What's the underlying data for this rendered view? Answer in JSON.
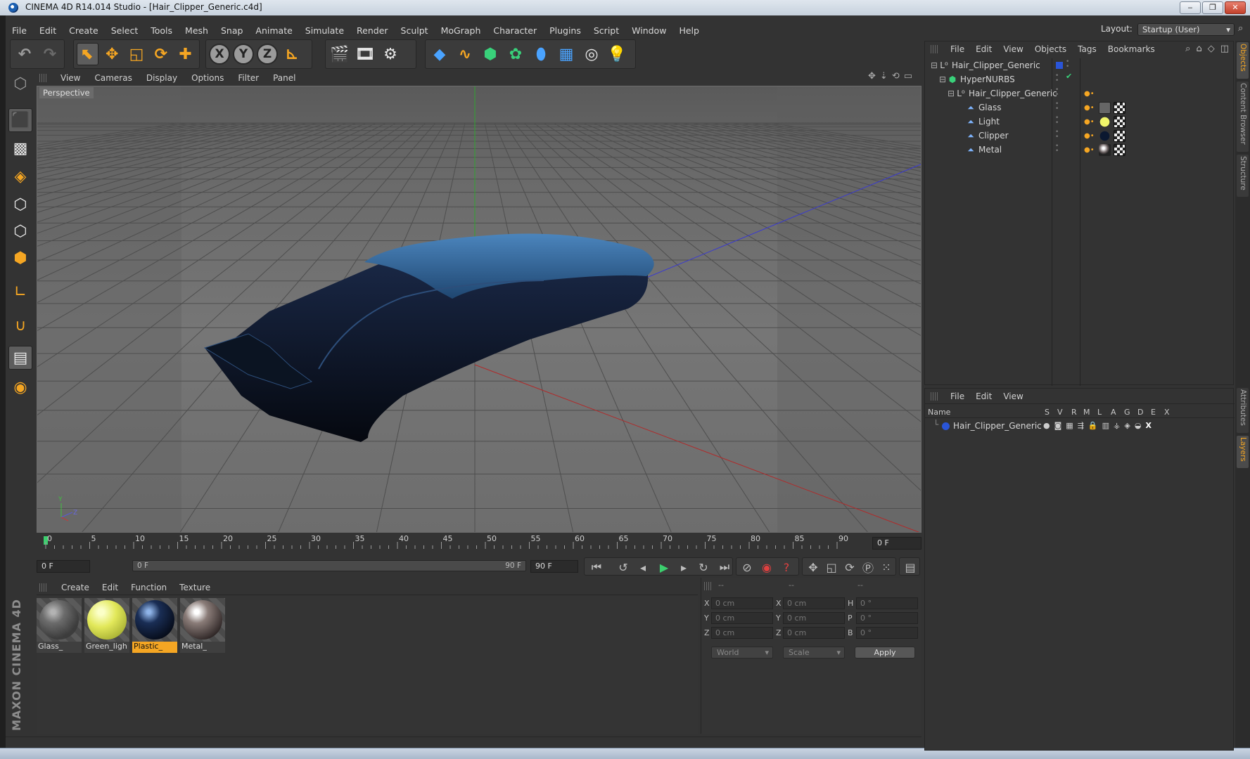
{
  "window": {
    "title": "CINEMA 4D R14.014 Studio - [Hair_Clipper_Generic.c4d]",
    "buttons": [
      "‒",
      "❐",
      "✕"
    ]
  },
  "menubar": [
    "File",
    "Edit",
    "Create",
    "Select",
    "Tools",
    "Mesh",
    "Snap",
    "Animate",
    "Simulate",
    "Render",
    "Sculpt",
    "MoGraph",
    "Character",
    "Plugins",
    "Script",
    "Window",
    "Help"
  ],
  "layout": {
    "label": "Layout:",
    "value": "Startup (User)"
  },
  "toolbar": {
    "axis_x": "X",
    "axis_y": "Y",
    "axis_z": "Z"
  },
  "viewport": {
    "menu": [
      "View",
      "Cameras",
      "Display",
      "Options",
      "Filter",
      "Panel"
    ],
    "camera_label": "Perspective",
    "axis_y": "Y",
    "axis_z": "Z",
    "colors": {
      "x_axis": "#b02a2a",
      "y_axis": "#2fa52f",
      "z_axis": "#3a3ad0",
      "model_body": "#0d1424",
      "model_top": "#2a5a8e"
    }
  },
  "timeline": {
    "ticks": [
      "0",
      "5",
      "10",
      "15",
      "20",
      "25",
      "30",
      "35",
      "40",
      "45",
      "50",
      "55",
      "60",
      "65",
      "70",
      "75",
      "80",
      "85",
      "90"
    ],
    "current_frame": "0 F",
    "start_field": "0 F",
    "range_start": "0 F",
    "range_end": "90 F",
    "end_field": "90 F"
  },
  "materials": {
    "menu": [
      "Create",
      "Edit",
      "Function",
      "Texture"
    ],
    "items": [
      {
        "label": "Glass_",
        "selected": false,
        "color": "#5a5a5a"
      },
      {
        "label": "Green_ligh",
        "selected": false,
        "color": "#e2e85a"
      },
      {
        "label": "Plastic_",
        "selected": true,
        "color": "#0b1830"
      },
      {
        "label": "Metal_",
        "selected": false,
        "color": "#6a6060"
      }
    ]
  },
  "coordinates": {
    "headers": [
      "--",
      "--",
      "--"
    ],
    "rows": [
      {
        "p_label": "X",
        "p_value": "0 cm",
        "s_label": "X",
        "s_value": "0 cm",
        "r_label": "H",
        "r_value": "0 °"
      },
      {
        "p_label": "Y",
        "p_value": "0 cm",
        "s_label": "Y",
        "s_value": "0 cm",
        "r_label": "P",
        "r_value": "0 °"
      },
      {
        "p_label": "Z",
        "p_value": "0 cm",
        "s_label": "Z",
        "s_value": "0 cm",
        "r_label": "B",
        "r_value": "0 °"
      }
    ],
    "space_dropdown": "World",
    "mode_dropdown": "Scale",
    "apply_label": "Apply"
  },
  "object_manager": {
    "menu": [
      "File",
      "Edit",
      "View",
      "Objects",
      "Tags",
      "Bookmarks"
    ],
    "objects": [
      {
        "name": "Hair_Clipper_Generic",
        "icon": "null-icon"
      },
      {
        "name": "HyperNURBS",
        "icon": "hypernurbs-icon"
      },
      {
        "name": "Hair_Clipper_Generic",
        "icon": "null-icon"
      },
      {
        "name": "Glass",
        "icon": "polygon-object-icon"
      },
      {
        "name": "Light",
        "icon": "polygon-object-icon"
      },
      {
        "name": "Clipper",
        "icon": "polygon-object-icon"
      },
      {
        "name": "Metal",
        "icon": "polygon-object-icon"
      }
    ]
  },
  "layer_manager": {
    "menu": [
      "File",
      "Edit",
      "View"
    ],
    "columns": [
      "Name",
      "S",
      "V",
      "R",
      "M",
      "L",
      "A",
      "G",
      "D",
      "E",
      "X"
    ],
    "rows": [
      {
        "name": "Hair_Clipper_Generic",
        "color": "#2a55d8"
      }
    ]
  },
  "side_tabs": [
    "Objects",
    "Content Browser",
    "Structure",
    "Attributes",
    "Layers"
  ],
  "branding": "MAXON CINEMA 4D"
}
